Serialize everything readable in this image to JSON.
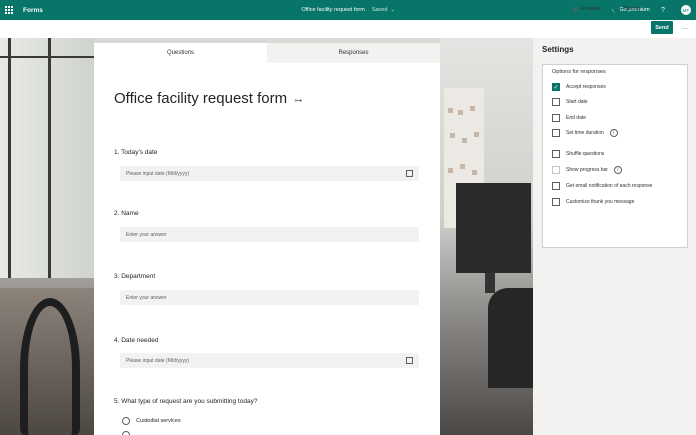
{
  "appbar": {
    "app_name": "Forms",
    "doc_title": "Office facility request form",
    "saved_status": "Saved",
    "premium_label": "Go premium",
    "help_label": "?",
    "avatar_initials": "MT"
  },
  "toolbar": {
    "preview_label": "Preview",
    "theme_label": "Theme",
    "send_label": "Send",
    "more_label": "···"
  },
  "tabs": {
    "questions": "Questions",
    "responses": "Responses"
  },
  "form": {
    "title": "Office facility request form",
    "questions": [
      {
        "label": "1. Today's date",
        "placeholder": "Please input date (M/d/yyyy)"
      },
      {
        "label": "2. Name",
        "placeholder": "Enter your answer"
      },
      {
        "label": "3. Department",
        "placeholder": "Enter your answer"
      },
      {
        "label": "4. Date needed",
        "placeholder": "Please input date (M/d/yyyy)"
      },
      {
        "label": "5. What type of request are you submitting today?",
        "options": [
          "Custodial services"
        ]
      }
    ]
  },
  "settings": {
    "title": "Settings",
    "subtitle": "Options for responses",
    "options": [
      {
        "label": "Accept responses",
        "checked": true
      },
      {
        "label": "Start date",
        "checked": false
      },
      {
        "label": "End date",
        "checked": false
      },
      {
        "label": "Set time duration",
        "checked": false
      },
      {
        "label": "Shuffle questions",
        "checked": false
      },
      {
        "label": "Show progress bar",
        "checked": false
      },
      {
        "label": "Get email notification of each response",
        "checked": false
      },
      {
        "label": "Customize thank you message",
        "checked": false
      }
    ]
  },
  "colors": {
    "brand": "#077568"
  }
}
